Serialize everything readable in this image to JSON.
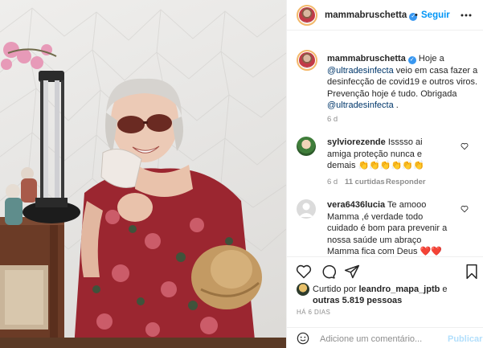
{
  "post": {
    "author": "mammabruschetta",
    "follow_label": "Seguir",
    "dot": "•",
    "caption": {
      "username": "mammabruschetta",
      "part1": " Hoje a ",
      "mention1": "@ultradesinfecta",
      "part2": " veio em casa fazer a desinfecção de covid19 e outros viros. Prevenção hoje é tudo. Obrigada ",
      "mention2": "@ultradesinfecta",
      "part3": " ."
    },
    "caption_age": "6 d"
  },
  "comments": [
    {
      "username": "sylviorezende",
      "text": " Isssso ai amiga proteção nunca e demais 👏👏👏👏👏👏",
      "age": "6 d",
      "likes": "11 curtidas",
      "reply": "Responder"
    },
    {
      "username": "vera6436lucia",
      "text": " Te amooo Mamma ,é verdade todo cuidado é bom para prevenir a nossa saúde um abraço Mamma fica com Deus ❤️❤️"
    }
  ],
  "likes": {
    "prefix": "Curtido por ",
    "user": "leandro_mapa_jptb",
    "middle": " e ",
    "others": "outras 5.819 pessoas"
  },
  "time_ago": "HÁ 6 DIAS",
  "add_comment": {
    "placeholder": "Adicione um comentário...",
    "publish": "Publicar"
  },
  "icons": [
    "verified-badge-icon",
    "heart-icon",
    "comment-icon",
    "share-icon",
    "bookmark-icon",
    "emoji-icon"
  ],
  "colors": {
    "link": "#0095f6",
    "mention": "#00376b",
    "muted": "#8e8e8e",
    "like_red": "#ed4956"
  }
}
